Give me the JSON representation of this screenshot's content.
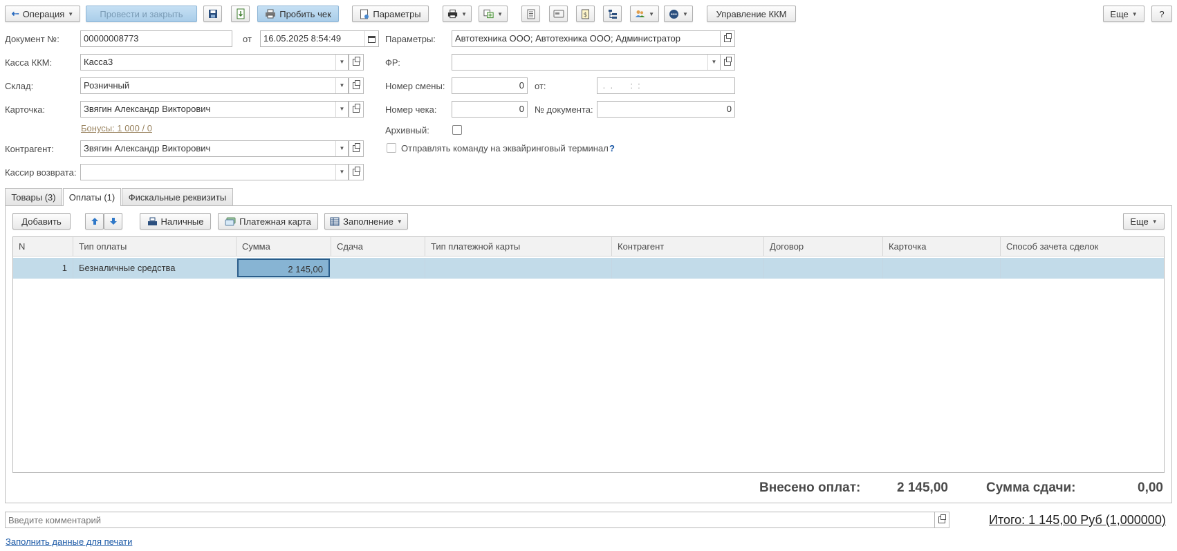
{
  "toolbar": {
    "operation_label": "Операция",
    "post_close_label": "Провести и закрыть",
    "print_check_label": "Пробить чек",
    "params_label": "Параметры",
    "kkm_label": "Управление ККМ",
    "more_label": "Еще",
    "help_label": "?"
  },
  "form": {
    "doc_no_label": "Документ №:",
    "doc_no_value": "00000008773",
    "from_label": "от",
    "date_value": "16.05.2025  8:54:49",
    "kassa_label": "Касса ККМ:",
    "kassa_value": "Касса3",
    "sklad_label": "Склад:",
    "sklad_value": "Розничный",
    "card_label": "Карточка:",
    "card_value": "Звягин Александр Викторович",
    "bonus_link": "Бонусы: 1 000 / 0",
    "contr_label": "Контрагент:",
    "contr_value": "Звягин Александр Викторович",
    "cashier_label": "Кассир возврата:",
    "cashier_value": "",
    "params_label": "Параметры:",
    "params_value": "Автотехника ООО; Автотехника ООО; Администратор",
    "fr_label": "ФР:",
    "fr_value": "",
    "shift_label": "Номер  смены:",
    "shift_value": "0",
    "shift_from_label": "от:",
    "shift_from_value": " .  .       :  :",
    "check_no_label": "Номер чека:",
    "check_no_value": "0",
    "doc_num_label": "№ документа:",
    "doc_num_value": "0",
    "archive_label": "Архивный:",
    "acquiring_label": "Отправлять команду на эквайринговый терминал",
    "acquiring_help": "?"
  },
  "tabs": [
    {
      "label": "Товары (3)"
    },
    {
      "label": "Оплаты (1)"
    },
    {
      "label": "Фискальные реквизиты"
    }
  ],
  "table_toolbar": {
    "add_label": "Добавить",
    "cash_label": "Наличные",
    "card_label": "Платежная карта",
    "fill_label": "Заполнение",
    "more_label": "Еще"
  },
  "table": {
    "columns": [
      "N",
      "Тип оплаты",
      "Сумма",
      "Сдача",
      "Тип платежной карты",
      "Контрагент",
      "Договор",
      "Карточка",
      "Способ зачета сделок"
    ],
    "rows": [
      {
        "n": "1",
        "type": "Безналичные средства",
        "sum": "2 145,00",
        "change": "",
        "card_type": "",
        "contr": "",
        "contract": "",
        "card": "",
        "method": ""
      }
    ]
  },
  "totals": {
    "paid_label": "Внесено оплат:",
    "paid_value": "2 145,00",
    "change_label": "Сумма сдачи:",
    "change_value": "0,00"
  },
  "footer": {
    "comment_placeholder": "Введите комментарий",
    "total_text": "Итого: 1 145,00 Руб (1,000000)",
    "print_data_link": "Заполнить данные для печати"
  },
  "colors": {
    "accent_blue": "#a9cde9",
    "selected_row": "#c2dbe9",
    "link": "#1a58a6"
  }
}
